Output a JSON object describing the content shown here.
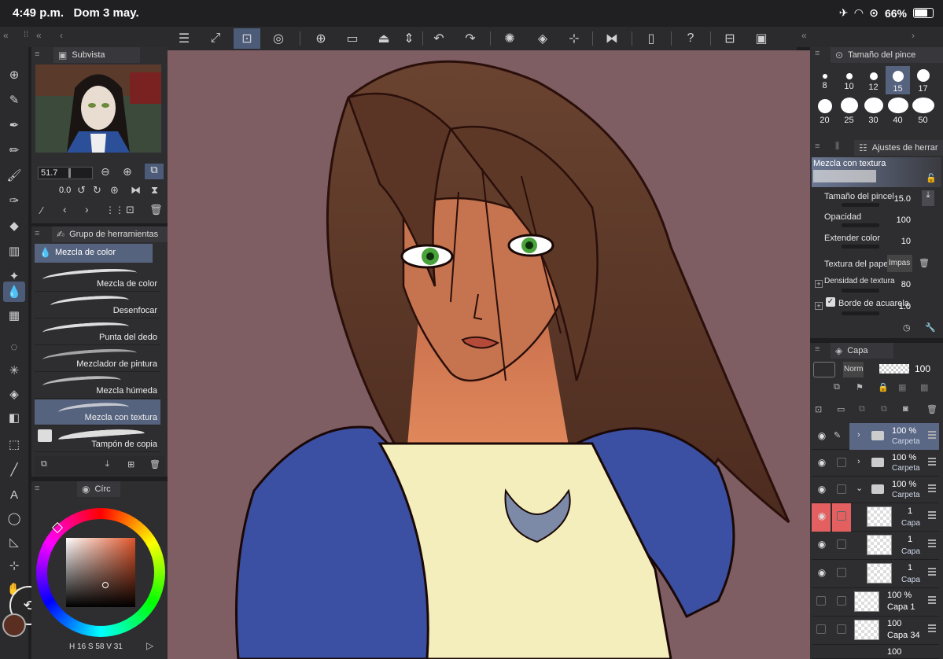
{
  "status": {
    "time": "4:49 p.m.",
    "date": "Dom 3 may.",
    "battery": "66%"
  },
  "navigator": {
    "title": "Subvista",
    "zoom": "51.7",
    "rotation": "0.0"
  },
  "subtool": {
    "group_title": "Grupo de herramientas",
    "current": "Mezcla de color",
    "items": [
      {
        "label": "Mezcla de color"
      },
      {
        "label": "Desenfocar"
      },
      {
        "label": "Punta del dedo"
      },
      {
        "label": "Mezclador de pintura"
      },
      {
        "label": "Mezcla húmeda"
      },
      {
        "label": "Mezcla con textura"
      },
      {
        "label": "Tampón de copia"
      }
    ]
  },
  "color": {
    "tab": "Círc",
    "h": "H",
    "h_val": "16",
    "s": "S",
    "s_val": "58",
    "v": "V",
    "v_val": "31",
    "main_color": "#5a2f22"
  },
  "brush_size": {
    "title": "Tamaño del pince",
    "sizes": [
      "8",
      "10",
      "12",
      "15",
      "17",
      "20",
      "25",
      "30",
      "40",
      "50"
    ],
    "selected": "15"
  },
  "tool_property": {
    "title": "Ajustes de herrar",
    "preset": "Mezcla con textura",
    "brush_size_label": "Tamaño del pincel",
    "brush_size_val": "15.0",
    "opacity_label": "Opacidad",
    "opacity_val": "100",
    "extend_label": "Extender color",
    "extend_val": "10",
    "paper_label": "Textura del papel",
    "paper_val": "Impas",
    "density_label": "Densidad de textura",
    "density_val": "80",
    "edge_label": "Borde de acuarela",
    "edge_val": "1.0"
  },
  "layers": {
    "title": "Capa",
    "blend": "Norm",
    "opacity": "100",
    "rows": [
      {
        "pct": "100 %",
        "name": "Carpeta"
      },
      {
        "pct": "100 %",
        "name": "Carpeta"
      },
      {
        "pct": "100 %",
        "name": "Carpeta"
      },
      {
        "pct": "1",
        "name": "Capa"
      },
      {
        "pct": "1",
        "name": "Capa"
      },
      {
        "pct": "1",
        "name": "Capa"
      },
      {
        "pct": "100 %",
        "name": "Capa 1"
      },
      {
        "pct": "100",
        "name": "Capa 34"
      },
      {
        "pct": "100",
        "name": ""
      }
    ]
  }
}
